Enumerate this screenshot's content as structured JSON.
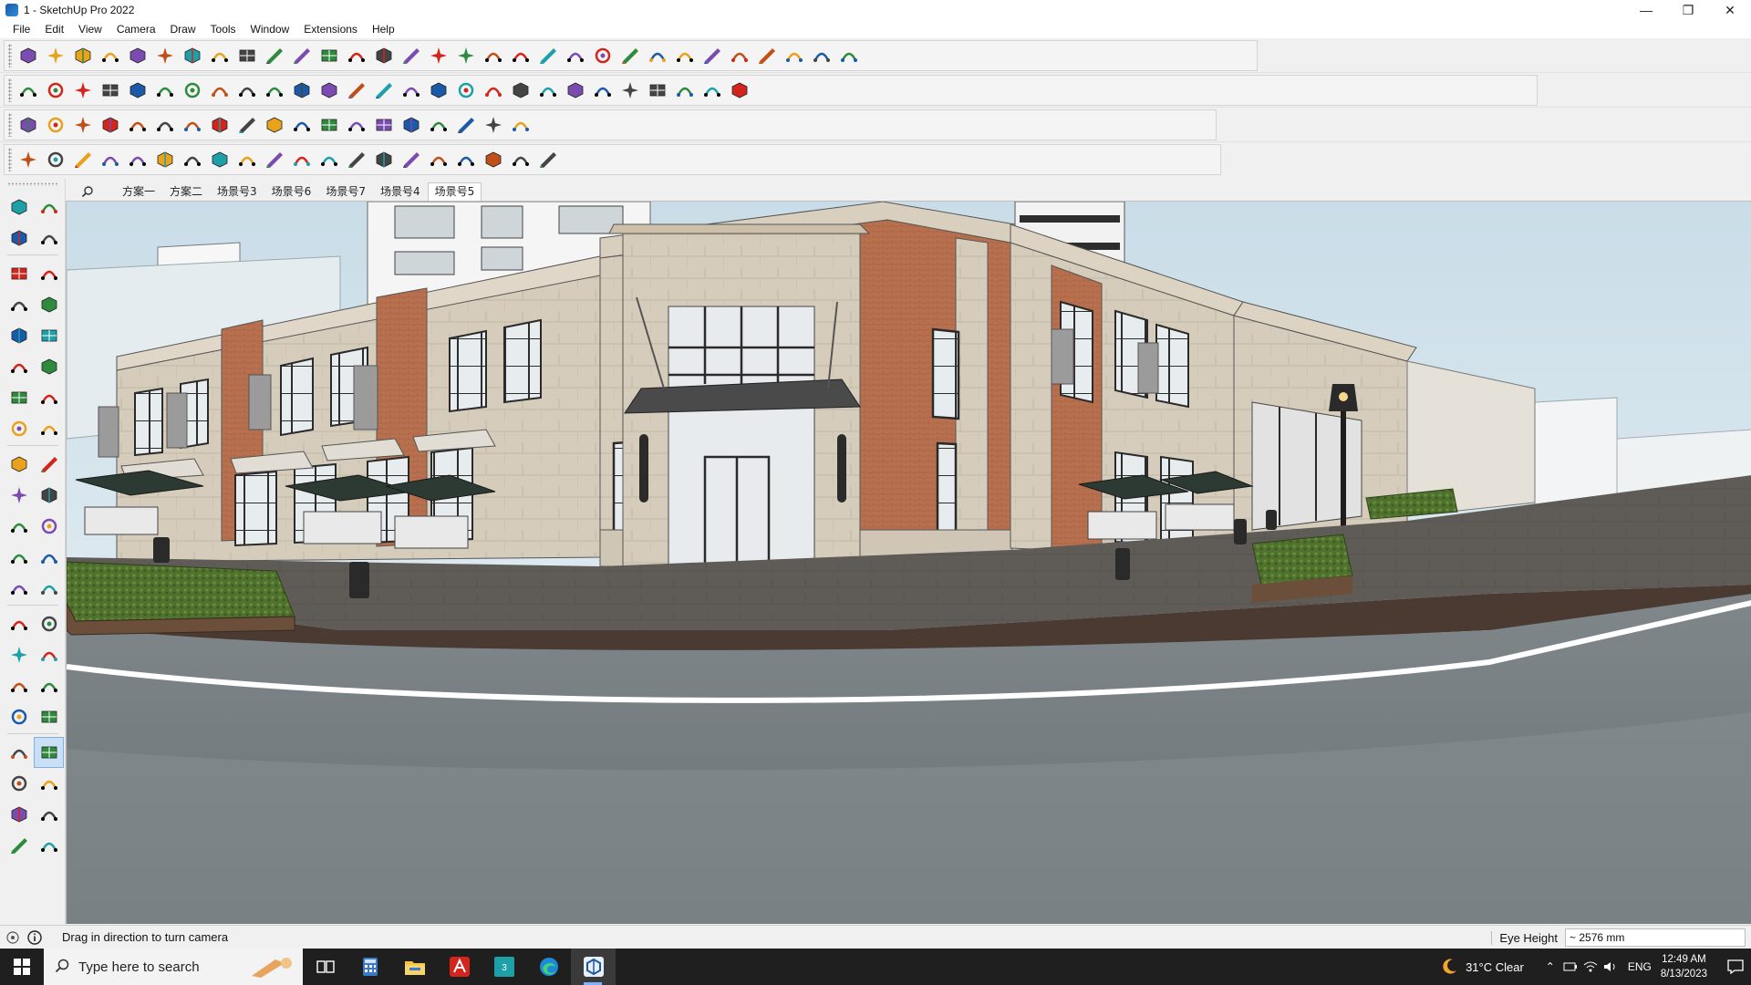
{
  "window": {
    "title": "1 - SketchUp Pro 2022",
    "controls": [
      "minimize-icon",
      "restore-icon",
      "close-icon"
    ]
  },
  "menu": [
    "File",
    "Edit",
    "View",
    "Camera",
    "Draw",
    "Tools",
    "Window",
    "Extensions",
    "Help"
  ],
  "toolbars": {
    "row1": [
      "zoom-window-icon",
      "select-icon",
      "eraser-icon",
      "line-icon",
      "arc-icon",
      "rectangle-icon",
      "push-pull-icon",
      "follow-me-icon",
      "move-icon",
      "rotate-icon",
      "scale-icon",
      "tape-measure-icon",
      "text-icon",
      "paint-bucket-icon",
      "orbit-icon",
      "pan-icon",
      "zoom-icon",
      "zoom-extents-icon",
      "x-ray-icon",
      "back-edges-icon",
      "layers-icon",
      "section-icon",
      "user-icon",
      "components-icon",
      "materials-icon",
      "styles-icon",
      "send-to-layout-icon",
      "sandbox-icon",
      "undo-icon",
      "redo-icon",
      "warehouse-icon"
    ],
    "row2": [
      "box-icon",
      "iso-view-icon",
      "top-view-icon",
      "front-view-icon",
      "right-view-icon",
      "back-view-icon",
      "left-view-icon",
      "bottom-view-icon",
      "solid-tools-icon",
      "shadows-icon",
      "fog-icon",
      "match-photo-icon",
      "home-icon",
      "house-icon",
      "outline-icon",
      "door-icon",
      "function-icon",
      "curve-tools-icon",
      "pen-icon",
      "circle-icon",
      "polygon-icon",
      "ellipse-icon",
      "shape-icon",
      "smoove-icon",
      "stamp-icon",
      "drape-icon",
      "flip-edge-icon"
    ],
    "row3": [
      "face-blue-icon",
      "plane-icon",
      "group-icon",
      "extrude-icon",
      "rotate-copy-icon",
      "array-icon",
      "mirror-icon",
      "joint-push-pull-icon",
      "loft-icon",
      "tube-icon",
      "weld-icon",
      "offset-icon",
      "fillet-icon",
      "chamfer-icon",
      "grid-icon",
      "texture-icon",
      "scatter-icon",
      "subdivide-icon",
      "cleanup-icon"
    ],
    "row4": [
      "bezier-icon",
      "spline-icon",
      "nurbs-icon",
      "trim-icon",
      "extend-icon",
      "round-corner-icon",
      "stair-icon",
      "railing-icon",
      "roof-icon",
      "wall-icon",
      "window-tool-icon",
      "hatch-icon",
      "profile-icon",
      "louver-icon",
      "slab-icon",
      "beam-icon",
      "column-icon",
      "truss-icon",
      "fence-icon",
      "deck-icon"
    ]
  },
  "left_tools": [
    [
      "select-arrow-icon",
      "orbit-tool-icon"
    ],
    [
      "paint-icon",
      "eraser-tool-icon"
    ],
    [
      "component-icon",
      "pencil-icon"
    ],
    [
      "line-tool-icon",
      "freehand-icon"
    ],
    [
      "rectangle-tool-icon",
      "rotated-rect-icon"
    ],
    [
      "circle-tool-icon",
      "polygon-tool-icon"
    ],
    [
      "arc-tool-icon",
      "arc2-tool-icon"
    ],
    [
      "arc3-tool-icon",
      "pie-icon"
    ],
    [
      "move-tool-icon",
      "push-pull-tool-icon"
    ],
    [
      "rotate-tool-icon",
      "follow-me-tool-icon"
    ],
    [
      "scale-tool-icon",
      "offset-tool-icon"
    ],
    [
      "tape-tool-icon",
      "dimension-icon"
    ],
    [
      "protractor-icon",
      "text-tool-icon"
    ],
    [
      "axes-icon",
      "3d-text-icon"
    ],
    [
      "orbit-camera-icon",
      "pan-camera-icon"
    ],
    [
      "zoom-camera-icon",
      "zoom-window-tool-icon"
    ],
    [
      "zoom-extents-tool-icon",
      "previous-view-icon"
    ],
    [
      "position-camera-icon",
      "look-around-icon"
    ],
    [
      "walk-icon",
      "section-plane-icon"
    ],
    [
      "display-section-icon",
      "section-cuts-icon"
    ],
    [
      "section-fill-icon",
      "section-fill-2-icon"
    ]
  ],
  "scene_tabs": [
    "方案一",
    "方案二",
    "场景号3",
    "场景号6",
    "场景号7",
    "场景号4",
    "场景号5"
  ],
  "active_scene": "场景号5",
  "status": {
    "hint": "Drag in direction to turn camera",
    "measure_label": "Eye Height",
    "measure_value": "~ 2576 mm"
  },
  "taskbar": {
    "search_placeholder": "Type here to search",
    "apps": [
      "task-view-icon",
      "calculator-icon",
      "file-explorer-icon",
      "acrobat-icon",
      "3dsmax-icon",
      "edge-icon",
      "sketchup-icon"
    ],
    "weather": "31°C  Clear",
    "lang": "ENG",
    "time": "12:49 AM",
    "date": "8/13/2023"
  },
  "colors": {
    "sky": "#dceaf2",
    "brick": "#b8704e",
    "stone": "#d2c7b5",
    "road": "#7c8488",
    "paving": "#5d5a57",
    "hedge": "#4f6e2e",
    "taskbar": "#1f1f1f"
  }
}
